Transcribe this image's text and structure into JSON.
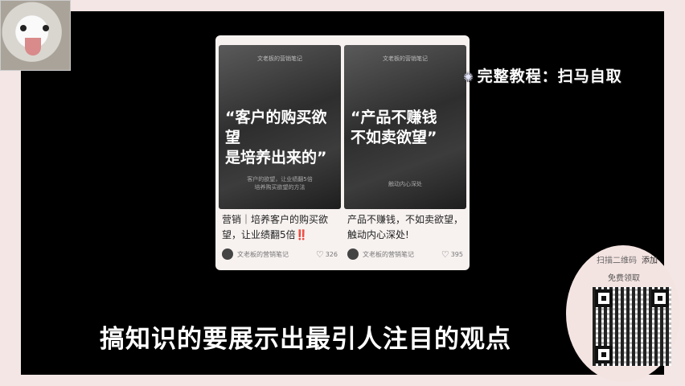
{
  "tutorial_tag": "完整教程：扫马自取",
  "subtitle": "搞知识的要展示出最引人注目的观点",
  "cards": [
    {
      "brand": "文老板的营销笔记",
      "quote_line1": "“客户的购买欲望",
      "quote_line2": "是培养出来的”",
      "sub_line1": "客户的欲望，让业绩翻5倍",
      "sub_line2": "培养购买欲望的方法",
      "caption": "营销｜培养客户的购买欲望，让业绩翻5倍‼️",
      "author": "文老板的营销笔记",
      "likes": "326"
    },
    {
      "brand": "文老板的营销笔记",
      "quote_line1": "“产品不赚钱",
      "quote_line2": "不如卖欲望”",
      "sub_line1": "触动内心深处",
      "sub_line2": "",
      "caption": "产品不赚钱，不如卖欲望，触动内心深处!",
      "author": "文老板的营销笔记",
      "likes": "395"
    }
  ],
  "promo": {
    "label": "扫描二维码",
    "action": "添加",
    "free": "免费领取"
  }
}
